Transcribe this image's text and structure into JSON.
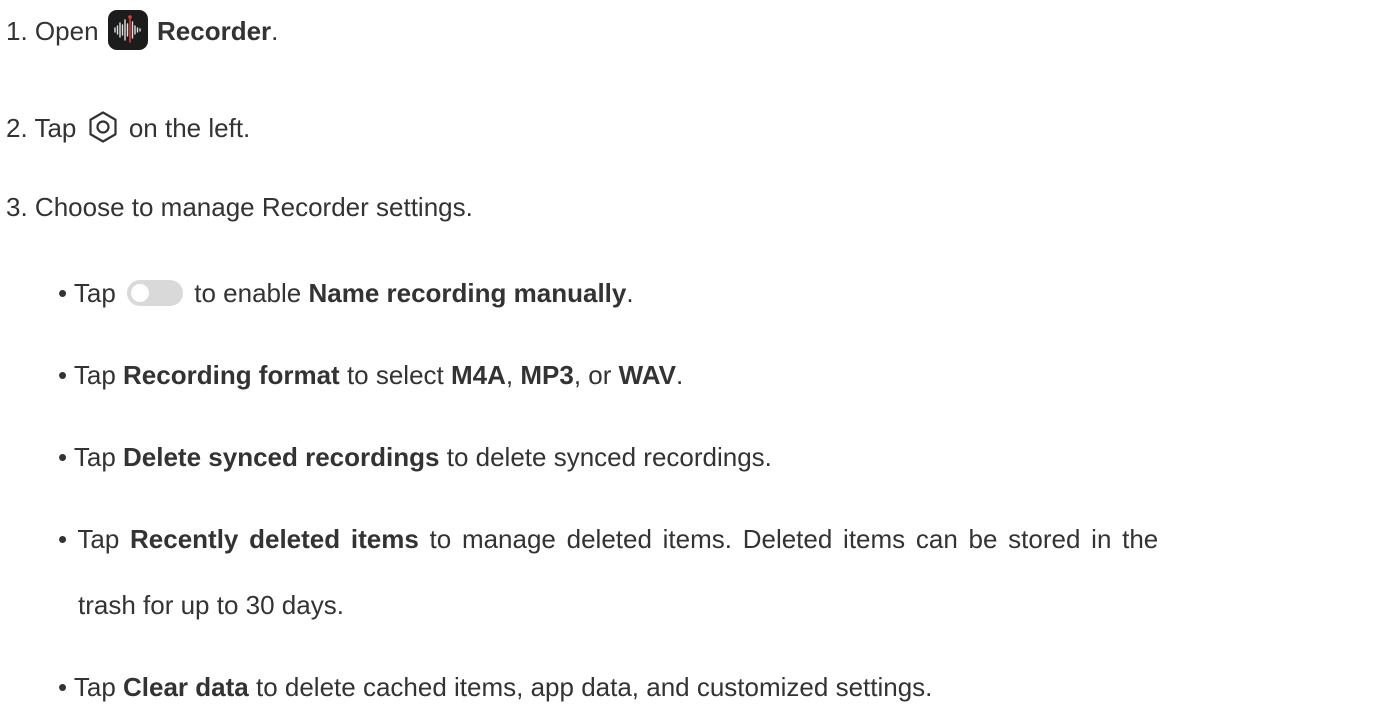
{
  "steps": [
    {
      "num": "1.",
      "t1": "Open",
      "b1": "Recorder",
      "t2": "."
    },
    {
      "num": "2.",
      "t1": "Tap",
      "t2": "on the left."
    },
    {
      "num": "3.",
      "t1": "Choose to manage Recorder settings."
    }
  ],
  "bullets": [
    {
      "t1": "• Tap",
      "t2": "to enable",
      "b1": "Name recording manually",
      "t3": "."
    },
    {
      "t1": "• Tap",
      "b1": "Recording format",
      "t2": "to select",
      "b2": "M4A",
      "t3": ",",
      "b3": "MP3",
      "t4": ", or",
      "b4": "WAV",
      "t5": "."
    },
    {
      "t1": "• Tap",
      "b1": "Delete synced recordings",
      "t2": "to delete synced recordings."
    },
    {
      "t1": "• Tap",
      "b1": "Recently deleted items",
      "t2": "to manage deleted items. Deleted items can be stored in the",
      "t3": "trash for up to 30 days."
    },
    {
      "t1": "• Tap",
      "b1": "Clear data",
      "t2": "to delete cached items, app data, and customized settings."
    }
  ],
  "icons": {
    "app": "recorder-app-icon",
    "settings": "settings-gear-icon",
    "toggle": "toggle-switch-off-icon"
  },
  "colors": {
    "text": "#333333",
    "app_bg": "#1c1c1c",
    "waveform": "#e0e0e0",
    "waveform_accent": "#e23b3b",
    "toggle_track": "#d9d9d9"
  }
}
